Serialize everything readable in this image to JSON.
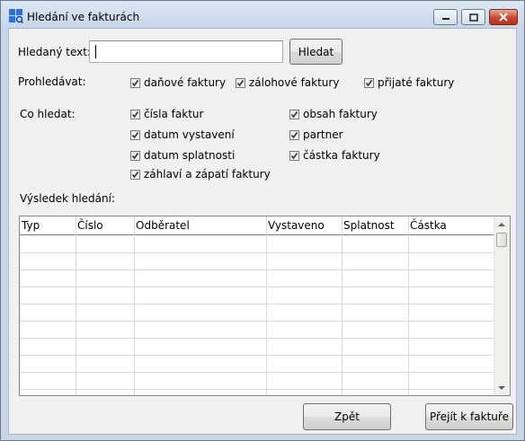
{
  "window": {
    "title": "Hledání ve fakturách",
    "app_icon": "windows-app-icon",
    "controls": {
      "minimize_icon": "minimize-icon",
      "maximize_icon": "maximize-icon",
      "close_icon": "close-icon"
    }
  },
  "search": {
    "label": "Hledaný text:",
    "value": "",
    "button_label": "Hledat"
  },
  "scope": {
    "label": "Prohledávat:",
    "options": [
      {
        "label": "daňové faktury",
        "checked": true
      },
      {
        "label": "zálohové faktury",
        "checked": true
      },
      {
        "label": "přijaté faktury",
        "checked": true
      }
    ]
  },
  "fields": {
    "label": "Co hledat:",
    "options": [
      {
        "label": "čísla faktur",
        "checked": true
      },
      {
        "label": "datum vystavení",
        "checked": true
      },
      {
        "label": "datum splatnosti",
        "checked": true
      },
      {
        "label": "záhlaví a zápatí faktury",
        "checked": true
      },
      {
        "label": "obsah faktury",
        "checked": true
      },
      {
        "label": "partner",
        "checked": true
      },
      {
        "label": "částka faktury",
        "checked": true
      }
    ]
  },
  "results": {
    "label": "Výsledek hledání:",
    "columns": [
      "Typ",
      "Číslo",
      "Odběratel",
      "Vystaveno",
      "Splatnost",
      "Částka"
    ],
    "rows": []
  },
  "footer": {
    "back_label": "Zpět",
    "goto_label": "Přejít k faktuře"
  },
  "colors": {
    "titlebar": "#c7d6e8",
    "client": "#f0f0f0",
    "close_button": "#c8472f"
  }
}
